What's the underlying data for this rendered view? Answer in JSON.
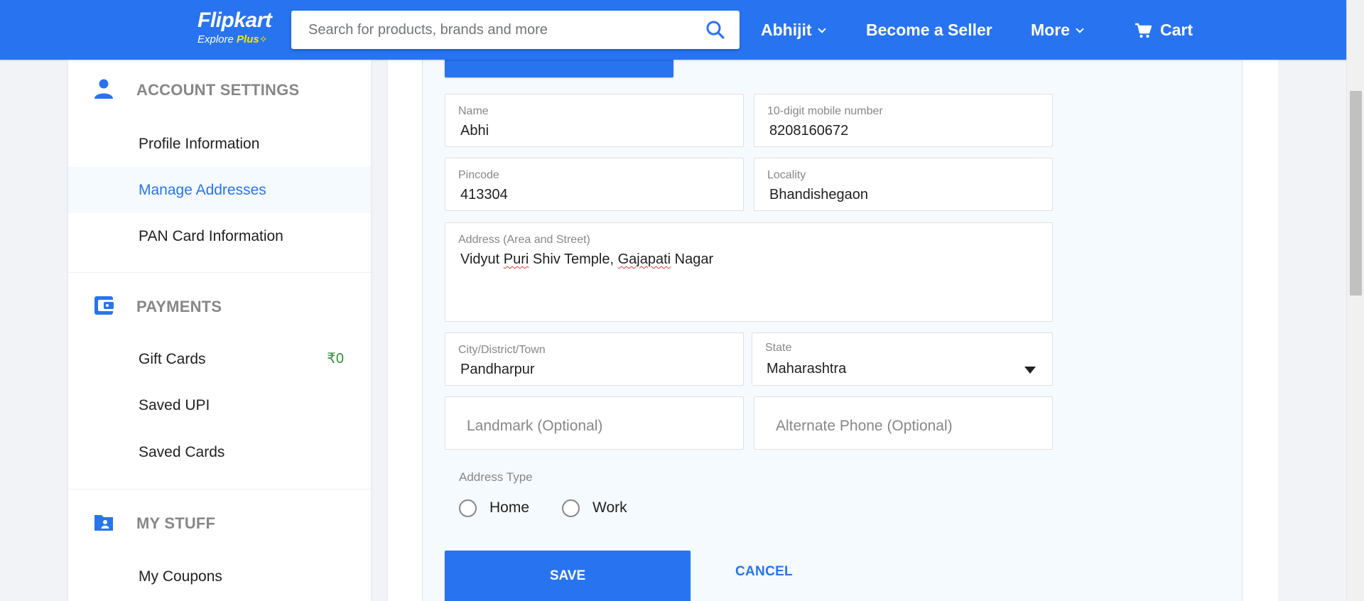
{
  "header": {
    "brand": "Flipkart",
    "sub_prefix": "Explore ",
    "sub_plus": "Plus",
    "search_placeholder": "Search for products, brands and more",
    "user": "Abhijit",
    "seller": "Become a Seller",
    "more": "More",
    "cart": "Cart",
    "icons": {
      "search": "search-icon",
      "cart": "cart-icon",
      "chevron": "chevron-down-icon"
    }
  },
  "sidebar": {
    "account": {
      "title": "ACCOUNT SETTINGS",
      "icon": "person-icon",
      "items": [
        {
          "label": "Profile Information"
        },
        {
          "label": "Manage Addresses",
          "active": true
        },
        {
          "label": "PAN Card Information"
        }
      ]
    },
    "payments": {
      "title": "PAYMENTS",
      "icon": "wallet-icon",
      "items": [
        {
          "label": "Gift Cards",
          "amount": "₹0"
        },
        {
          "label": "Saved UPI"
        },
        {
          "label": "Saved Cards"
        }
      ]
    },
    "mystuff": {
      "title": "MY STUFF",
      "icon": "folder-user-icon",
      "items": [
        {
          "label": "My Coupons"
        }
      ]
    }
  },
  "form": {
    "name": {
      "label": "Name",
      "value": "Abhi"
    },
    "mobile": {
      "label": "10-digit mobile number",
      "value": "8208160672"
    },
    "pincode": {
      "label": "Pincode",
      "value": "413304"
    },
    "locality": {
      "label": "Locality",
      "value": "Bhandishegaon"
    },
    "address": {
      "label": "Address (Area and Street)",
      "v1": "Vidyut ",
      "v2": "Puri",
      "v3": " Shiv Temple, ",
      "v4": "Gajapati",
      "v5": " Nagar"
    },
    "city": {
      "label": "City/District/Town",
      "value": "Pandharpur"
    },
    "state": {
      "label": "State",
      "value": "Maharashtra"
    },
    "landmark": {
      "placeholder": "Landmark (Optional)"
    },
    "alt_phone": {
      "placeholder": "Alternate Phone (Optional)"
    },
    "address_type": {
      "label": "Address Type",
      "options": [
        "Home",
        "Work"
      ]
    },
    "save": "SAVE",
    "cancel": "CANCEL"
  },
  "colors": {
    "brand_blue": "#2874f0",
    "accent_yellow": "#ffe500",
    "green": "#388e3c"
  }
}
